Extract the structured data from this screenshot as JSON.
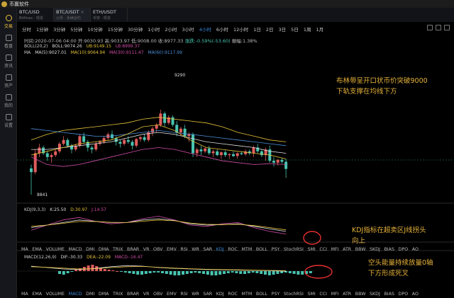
{
  "app": {
    "name": "币赢软件"
  },
  "sidebar": [
    {
      "label": "交易",
      "active": true
    },
    {
      "label": "看盘",
      "active": false
    },
    {
      "label": "资讯",
      "active": false
    },
    {
      "label": "资产",
      "active": false
    },
    {
      "label": "我的",
      "active": false
    },
    {
      "label": "设置",
      "active": false
    }
  ],
  "tabs": [
    {
      "pair": "BTC/USD",
      "sub": "Bitfinex · 现货",
      "active": false
    },
    {
      "pair": "BTC/USDT",
      "sub": "火币 · 永续合约",
      "active": true
    },
    {
      "pair": "ETH/USDT",
      "sub": "币安 · 现货",
      "active": false
    }
  ],
  "periods": [
    "分时",
    "1分钟",
    "3分钟",
    "5分钟",
    "10分钟",
    "15分钟",
    "30分钟",
    "1小时",
    "2小时",
    "3小时",
    "4小时",
    "6小时",
    "12小时",
    "1日",
    "2日",
    "3日",
    "5日",
    "1周",
    "1月"
  ],
  "active_period": "4小时",
  "info": {
    "time": "时间:2020-07-06 04:00",
    "open": "开:9030.93",
    "high": "高:9033.97",
    "low": "低:9008.00",
    "close": "收:8977.33",
    "change": "涨跌:-0.59%(-53.60)",
    "amplitude": "振幅:1.38%"
  },
  "boll_legend": {
    "name": "BOLL(20,2)",
    "boll": "BOLL:9074.26",
    "ub": "UB:9149.15",
    "lb": "LB:8999.37"
  },
  "ma_legend": {
    "name": "MA",
    "ma5": "MA(5):9027.01",
    "ma10": "MA(10):9064.94",
    "ma30": "MA(30):9111.47",
    "ma60": "MA(60):9117.99"
  },
  "price_marks": {
    "high": "9290",
    "low": "8841"
  },
  "annotations": {
    "boll": [
      "布林带呈开口状币价突破9000",
      "下轨支撑在均线下方"
    ],
    "kdj": [
      "KDJ指标在超卖区J线拐头",
      "向上"
    ],
    "macd": [
      "空头能量持续放量0轴",
      "下方形成死叉"
    ]
  },
  "kdj_legend": {
    "name": "KDJ(9,3,3)",
    "k": "K:25.50",
    "d": "D:30.97",
    "j": "J:14.57"
  },
  "macd_legend": {
    "name": "MACD(12,26,9)",
    "dif": "DIF:-30.33",
    "dea": "DEA:-22.09",
    "macd": "MACD:-16.47"
  },
  "indicators": [
    "MA",
    "EMA",
    "VOLUME",
    "MACD",
    "DMI",
    "DMA",
    "TRIX",
    "BRAR",
    "VR",
    "OBV",
    "EMV",
    "RSI",
    "WR",
    "SAR",
    "KDJ",
    "ROC",
    "MTM",
    "BOLL",
    "PSY",
    "StochRSI",
    "SMI",
    "CCI",
    "MFI",
    "ATR",
    "BBW",
    "SKDJ",
    "BIAS",
    "DPO",
    "AO"
  ],
  "indicator_active_row1": "KDJ",
  "indicator_active_row2": "MACD",
  "colors": {
    "up": "#e05c5c",
    "down": "#49c4b0",
    "accent": "#e6b33a",
    "highlight": "#e53030"
  }
}
